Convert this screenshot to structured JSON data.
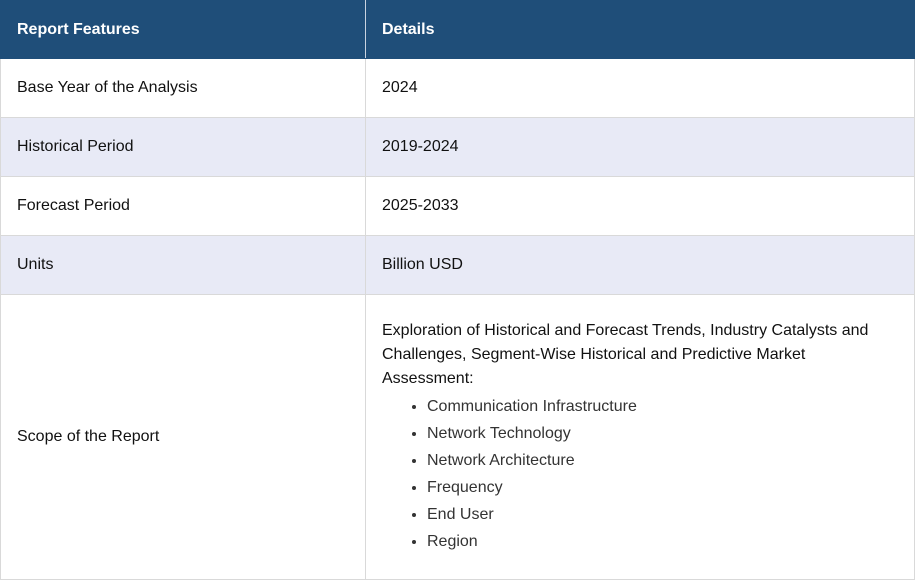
{
  "table": {
    "headers": [
      "Report Features",
      "Details"
    ],
    "rows": [
      {
        "feature": "Base Year of the Analysis",
        "detail": "2024"
      },
      {
        "feature": "Historical Period",
        "detail": "2019-2024"
      },
      {
        "feature": "Forecast Period",
        "detail": "2025-2033"
      },
      {
        "feature": "Units",
        "detail": "Billion USD"
      }
    ],
    "scope": {
      "feature": "Scope of the Report",
      "intro": "Exploration of Historical and Forecast Trends, Industry Catalysts and Challenges, Segment-Wise Historical and Predictive Market Assessment:",
      "items": [
        "Communication Infrastructure",
        "Network Technology",
        "Network Architecture",
        "Frequency",
        "End User",
        "Region"
      ]
    }
  },
  "colors": {
    "header_bg": "#1f4e79",
    "header_text": "#ffffff",
    "alt_row_bg": "#e8eaf6",
    "border": "#d9d9d9"
  }
}
